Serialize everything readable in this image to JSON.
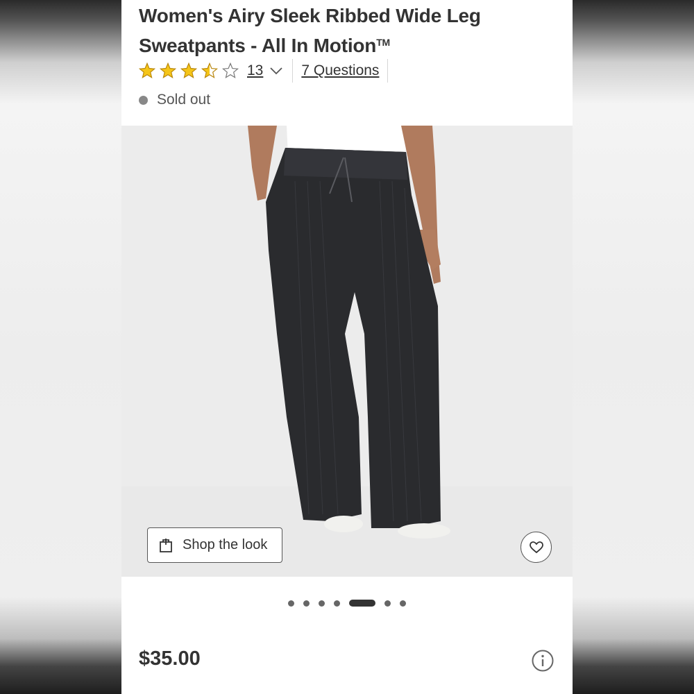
{
  "product": {
    "title": "Women's Airy Sleek Ribbed Wide Leg Sweatpants - All In Motion",
    "trademark": "TM",
    "rating": 3.5,
    "rating_max": 5,
    "review_count": "13",
    "questions_link": "7 Questions",
    "availability": "Sold out",
    "price": "$35.00"
  },
  "image_carousel": {
    "total_slides": 7,
    "active_slide": 5
  },
  "actions": {
    "shop_the_look_label": "Shop the look"
  },
  "icons": {
    "star": "star-icon",
    "chevron": "chevron-down-icon",
    "bag": "shopping-bag-icon",
    "heart": "heart-icon",
    "info": "info-icon"
  },
  "colors": {
    "star_fill": "#f5c518",
    "text_primary": "#333333",
    "status_dot": "#888888"
  }
}
